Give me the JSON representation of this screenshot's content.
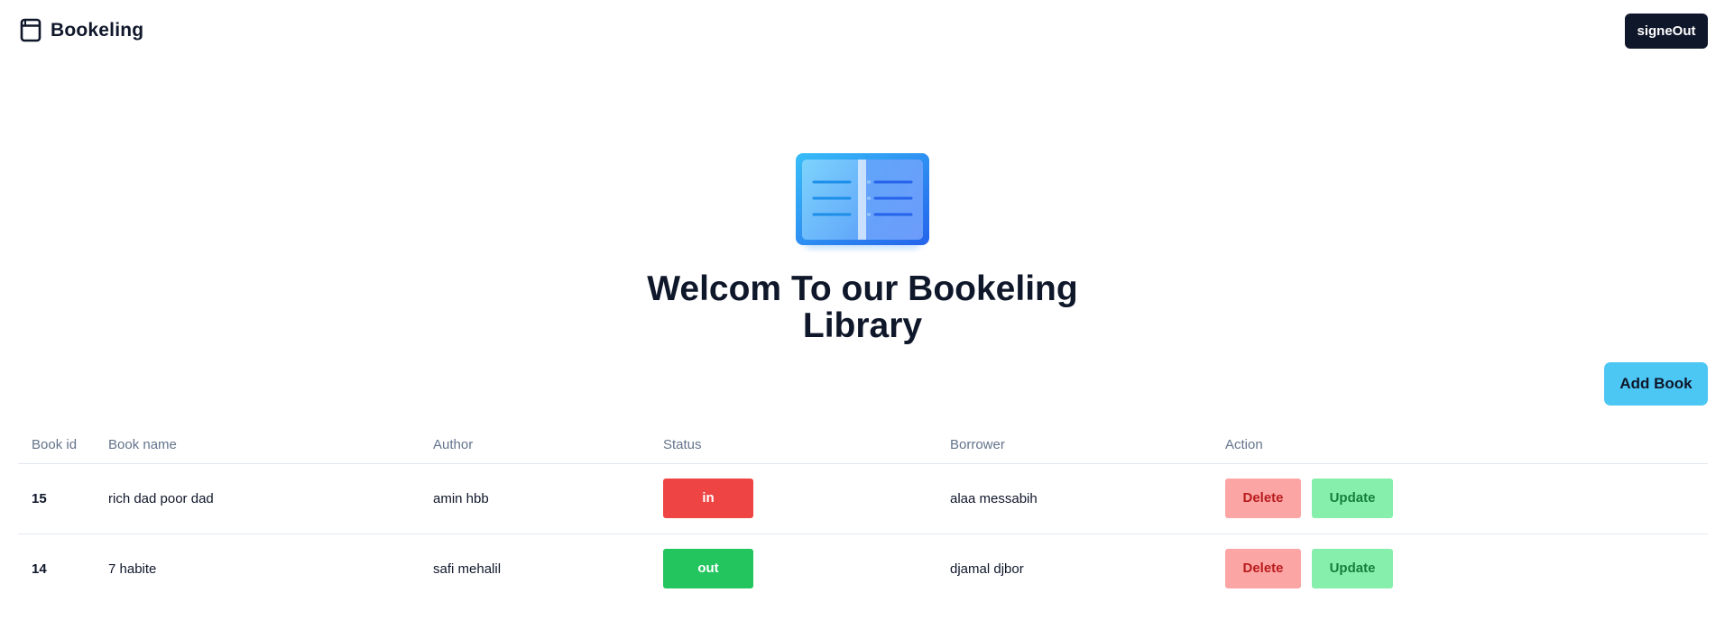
{
  "header": {
    "brand_name": "Bookeling",
    "brand_icon": "book-icon",
    "signout_label": "signeOut"
  },
  "hero": {
    "icon": "open-book-icon",
    "title": "Welcom To our Bookeling Library"
  },
  "actions": {
    "add_book_label": "Add Book"
  },
  "table": {
    "columns": [
      "Book id",
      "Book name",
      "Author",
      "Status",
      "Borrower",
      "Action"
    ],
    "rows": [
      {
        "id": "15",
        "name": "rich dad poor dad",
        "author": "amin hbb",
        "status": "in",
        "borrower": "alaa messabih",
        "delete_label": "Delete",
        "update_label": "Update"
      },
      {
        "id": "14",
        "name": "7 habite",
        "author": "safi mehalil",
        "status": "out",
        "borrower": "djamal djbor",
        "delete_label": "Delete",
        "update_label": "Update"
      }
    ]
  },
  "colors": {
    "primary_dark": "#0f172a",
    "add_button": "#4cc6f3",
    "status_in": "#ef4444",
    "status_out": "#22c55e",
    "delete_bg": "#fca5a5",
    "update_bg": "#86efac"
  }
}
